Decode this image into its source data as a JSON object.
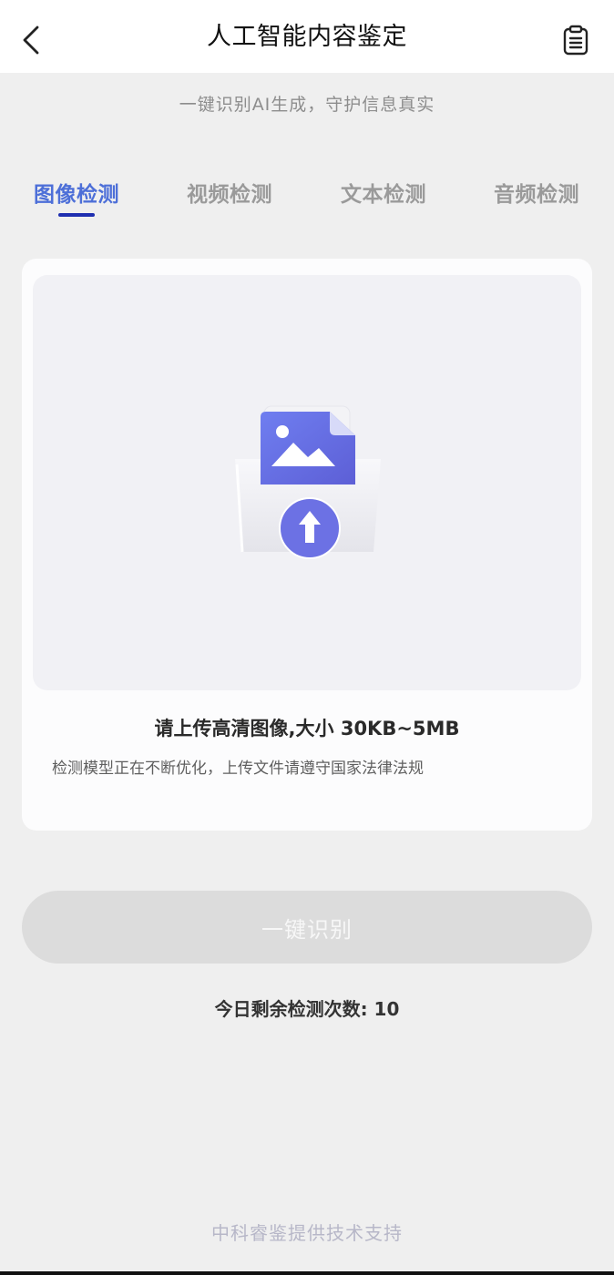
{
  "header": {
    "title": "人工智能内容鉴定"
  },
  "subtitle": "一键识别AI生成，守护信息真实",
  "tabs": [
    {
      "label": "图像检测",
      "active": true
    },
    {
      "label": "视频检测",
      "active": false
    },
    {
      "label": "文本检测",
      "active": false
    },
    {
      "label": "音频检测",
      "active": false
    }
  ],
  "upload": {
    "hint": "请上传高清图像,大小 30KB~5MB",
    "notice": "检测模型正在不断优化，上传文件请遵守国家法律法规"
  },
  "identify_button": {
    "label": "一键识别",
    "enabled": false
  },
  "remaining": "今日剩余检测次数: 10",
  "footer": "中科睿鉴提供技术支持",
  "icons": {
    "back": "chevron-left-icon",
    "history": "clipboard-list-icon",
    "upload": "image-upload-icon"
  },
  "colors": {
    "accent": "#4d6fd8",
    "tab_underline": "#1f2fb0",
    "tab_inactive": "#9a9a9a",
    "button_disabled": "#dcdcdc",
    "page_bg": "#efefef",
    "illustration_purple": "#6f76e6"
  }
}
